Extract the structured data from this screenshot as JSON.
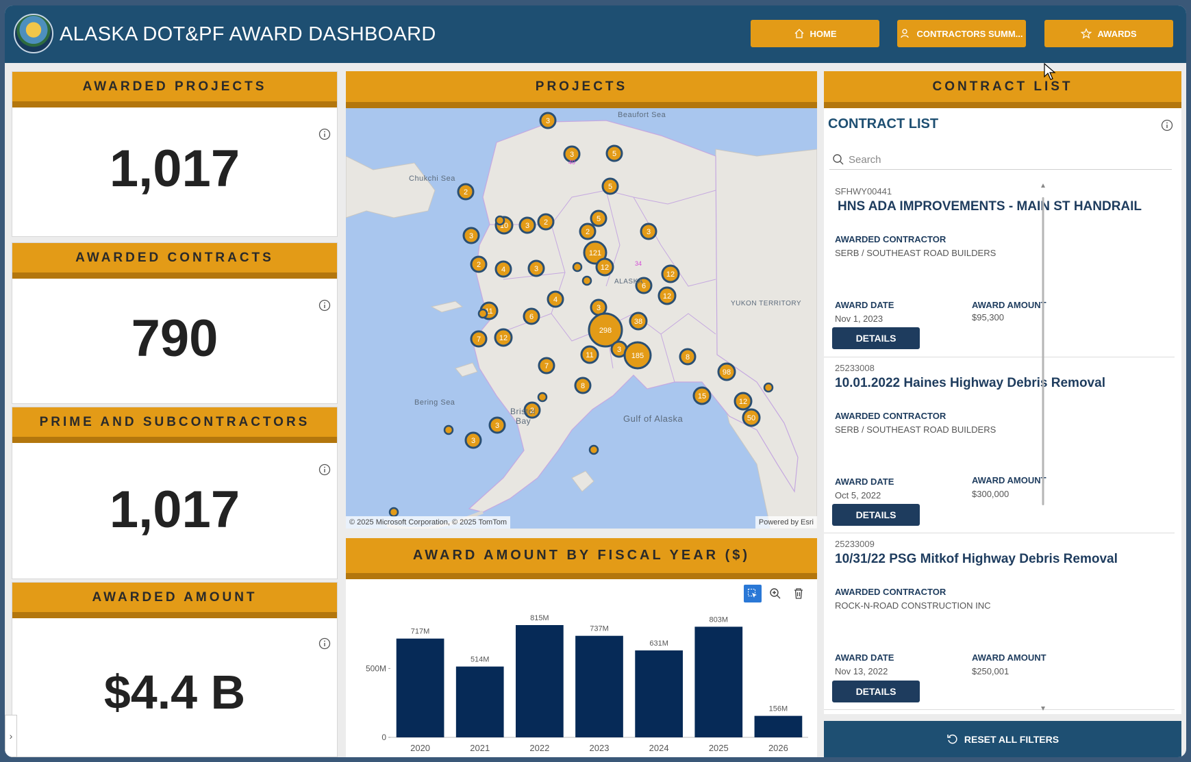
{
  "header": {
    "title": "ALASKA DOT&PF AWARD DASHBOARD",
    "nav": [
      {
        "label": "HOME",
        "icon": "home-icon"
      },
      {
        "label": "CONTRACTORS SUMM...",
        "icon": "user-icon"
      },
      {
        "label": "AWARDS",
        "icon": "star-icon"
      }
    ]
  },
  "kpis": [
    {
      "title": "AWARDED PROJECTS",
      "value": "1,017"
    },
    {
      "title": "AWARDED CONTRACTS",
      "value": "790"
    },
    {
      "title": "PRIME AND SUBCONTRACTORS",
      "value": "1,017"
    },
    {
      "title": "AWARDED AMOUNT",
      "value": "$4.4 B"
    }
  ],
  "map": {
    "title": "PROJECTS",
    "labels": [
      "Beaufort Sea",
      "Chukchi Sea",
      "Bering Sea",
      "Bristol",
      "Bay",
      "Gulf of Alaska",
      "YUKON TERRITORY",
      "ALASKA"
    ],
    "clusters": [
      "3",
      "3",
      "5",
      "5",
      "2",
      "5",
      "10",
      "3",
      "2",
      "3",
      "2",
      "3",
      "121",
      "12",
      "2",
      "4",
      "3",
      "12",
      "6",
      "12",
      "4",
      "11",
      "6",
      "38",
      "3",
      "298",
      "7",
      "12",
      "3",
      "185",
      "8",
      "11",
      "7",
      "8",
      "98",
      "15",
      "12",
      "2",
      "3",
      "3",
      "50",
      "40",
      "34"
    ],
    "credit_left": "© 2025 Microsoft Corporation, © 2025 TomTom",
    "credit_right": "Powered by Esri"
  },
  "chart": {
    "title": "AWARD AMOUNT BY FISCAL YEAR ($)",
    "tools": [
      "select-icon",
      "zoom-icon",
      "trash-icon"
    ]
  },
  "chart_data": {
    "type": "bar",
    "title": "AWARD AMOUNT BY FISCAL YEAR ($)",
    "categories": [
      "2020",
      "2021",
      "2022",
      "2023",
      "2024",
      "2025",
      "2026"
    ],
    "values": [
      717,
      514,
      815,
      737,
      631,
      803,
      156
    ],
    "data_labels": [
      "717M",
      "514M",
      "815M",
      "737M",
      "631M",
      "803M",
      "156M"
    ],
    "yticks": [
      0,
      500
    ],
    "ytick_labels": [
      "0",
      "500M"
    ],
    "ylim": [
      0,
      815
    ],
    "color": "#062a57",
    "grid": false,
    "legend": "none"
  },
  "contract_list": {
    "panel_title": "CONTRACT LIST",
    "title": "CONTRACT LIST",
    "search_placeholder": "Search",
    "contractor_label": "AWARDED CONTRACTOR",
    "date_label": "AWARD DATE",
    "amount_label": "AWARD AMOUNT",
    "details_label": "DETAILS",
    "items": [
      {
        "id": "SFHWY00441",
        "title": "HNS ADA IMPROVEMENTS - MAIN ST HANDRAIL",
        "contractor": "SERB / SOUTHEAST ROAD BUILDERS",
        "date": "Nov 1, 2023",
        "amount": "$95,300"
      },
      {
        "id": "25233008",
        "title": "10.01.2022 Haines Highway Debris Removal",
        "contractor": "SERB / SOUTHEAST ROAD BUILDERS",
        "date": "Oct 5, 2022",
        "amount": "$300,000"
      },
      {
        "id": "25233009",
        "title": "10/31/22 PSG Mitkof Highway Debris Removal",
        "contractor": "ROCK-N-ROAD CONSTRUCTION INC",
        "date": "Nov 13, 2022",
        "amount": "$250,001"
      }
    ]
  },
  "reset_label": "RESET ALL FILTERS",
  "colors": {
    "header": "#1e4f72",
    "accent": "#e39b17",
    "accent_dark": "#b3760d",
    "bar": "#062a57",
    "cluster": "#e39b17",
    "cluster_ring": "#2a4f73"
  }
}
